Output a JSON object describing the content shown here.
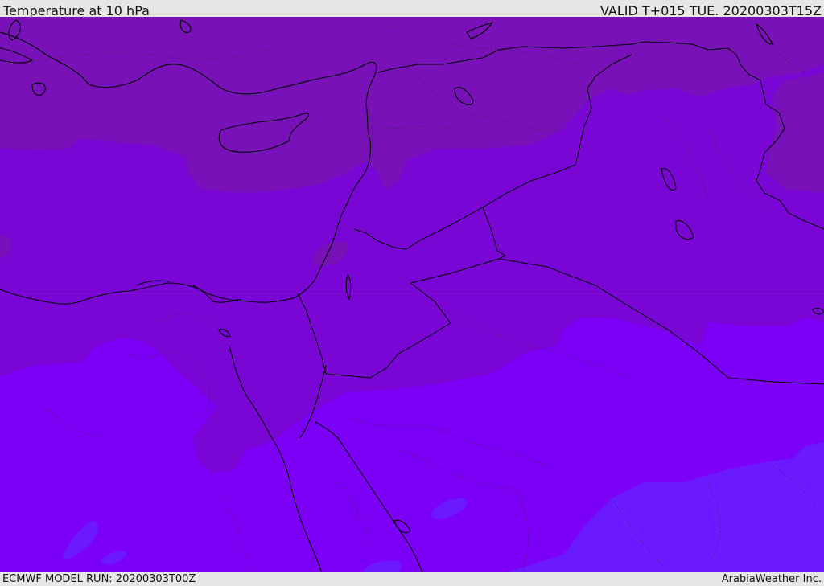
{
  "header": {
    "title": "Temperature at 10 hPa",
    "valid": "VALID T+015 TUE. 20200303T15Z"
  },
  "footer": {
    "model_run": "ECMWF MODEL RUN: 20200303T00Z",
    "credit": "ArabiaWeather Inc."
  },
  "map": {
    "field": "Temperature at 10 hPa",
    "colors": {
      "warmest_band": "#7812b8",
      "mid_band": "#7a06d6",
      "cool_band": "#7d00f6",
      "coldest_band": "#6b1aff",
      "coastline": "#000000",
      "border": "#000000"
    }
  }
}
